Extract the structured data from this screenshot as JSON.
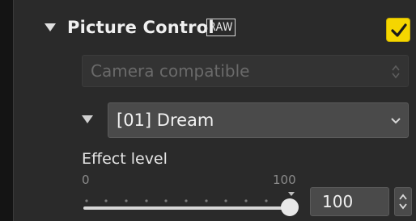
{
  "picture_control": {
    "title": "Picture Control",
    "raw_badge": "RAW",
    "enabled": true,
    "compatibility": {
      "value": "Camera compatible"
    },
    "preset": {
      "value": "[01] Dream"
    },
    "effect_level": {
      "label": "Effect level",
      "min_label": "0",
      "max_label": "100",
      "value": "100",
      "slider_fraction": 1.0
    }
  },
  "colors": {
    "checkbox": "#f5d600",
    "panel": "#2a2a2a"
  },
  "icons": {
    "collapse": "triangle-down-icon",
    "check": "checkmark-icon",
    "chevron": "chevron-down-icon",
    "stepper": "spinner-arrows-icon"
  }
}
